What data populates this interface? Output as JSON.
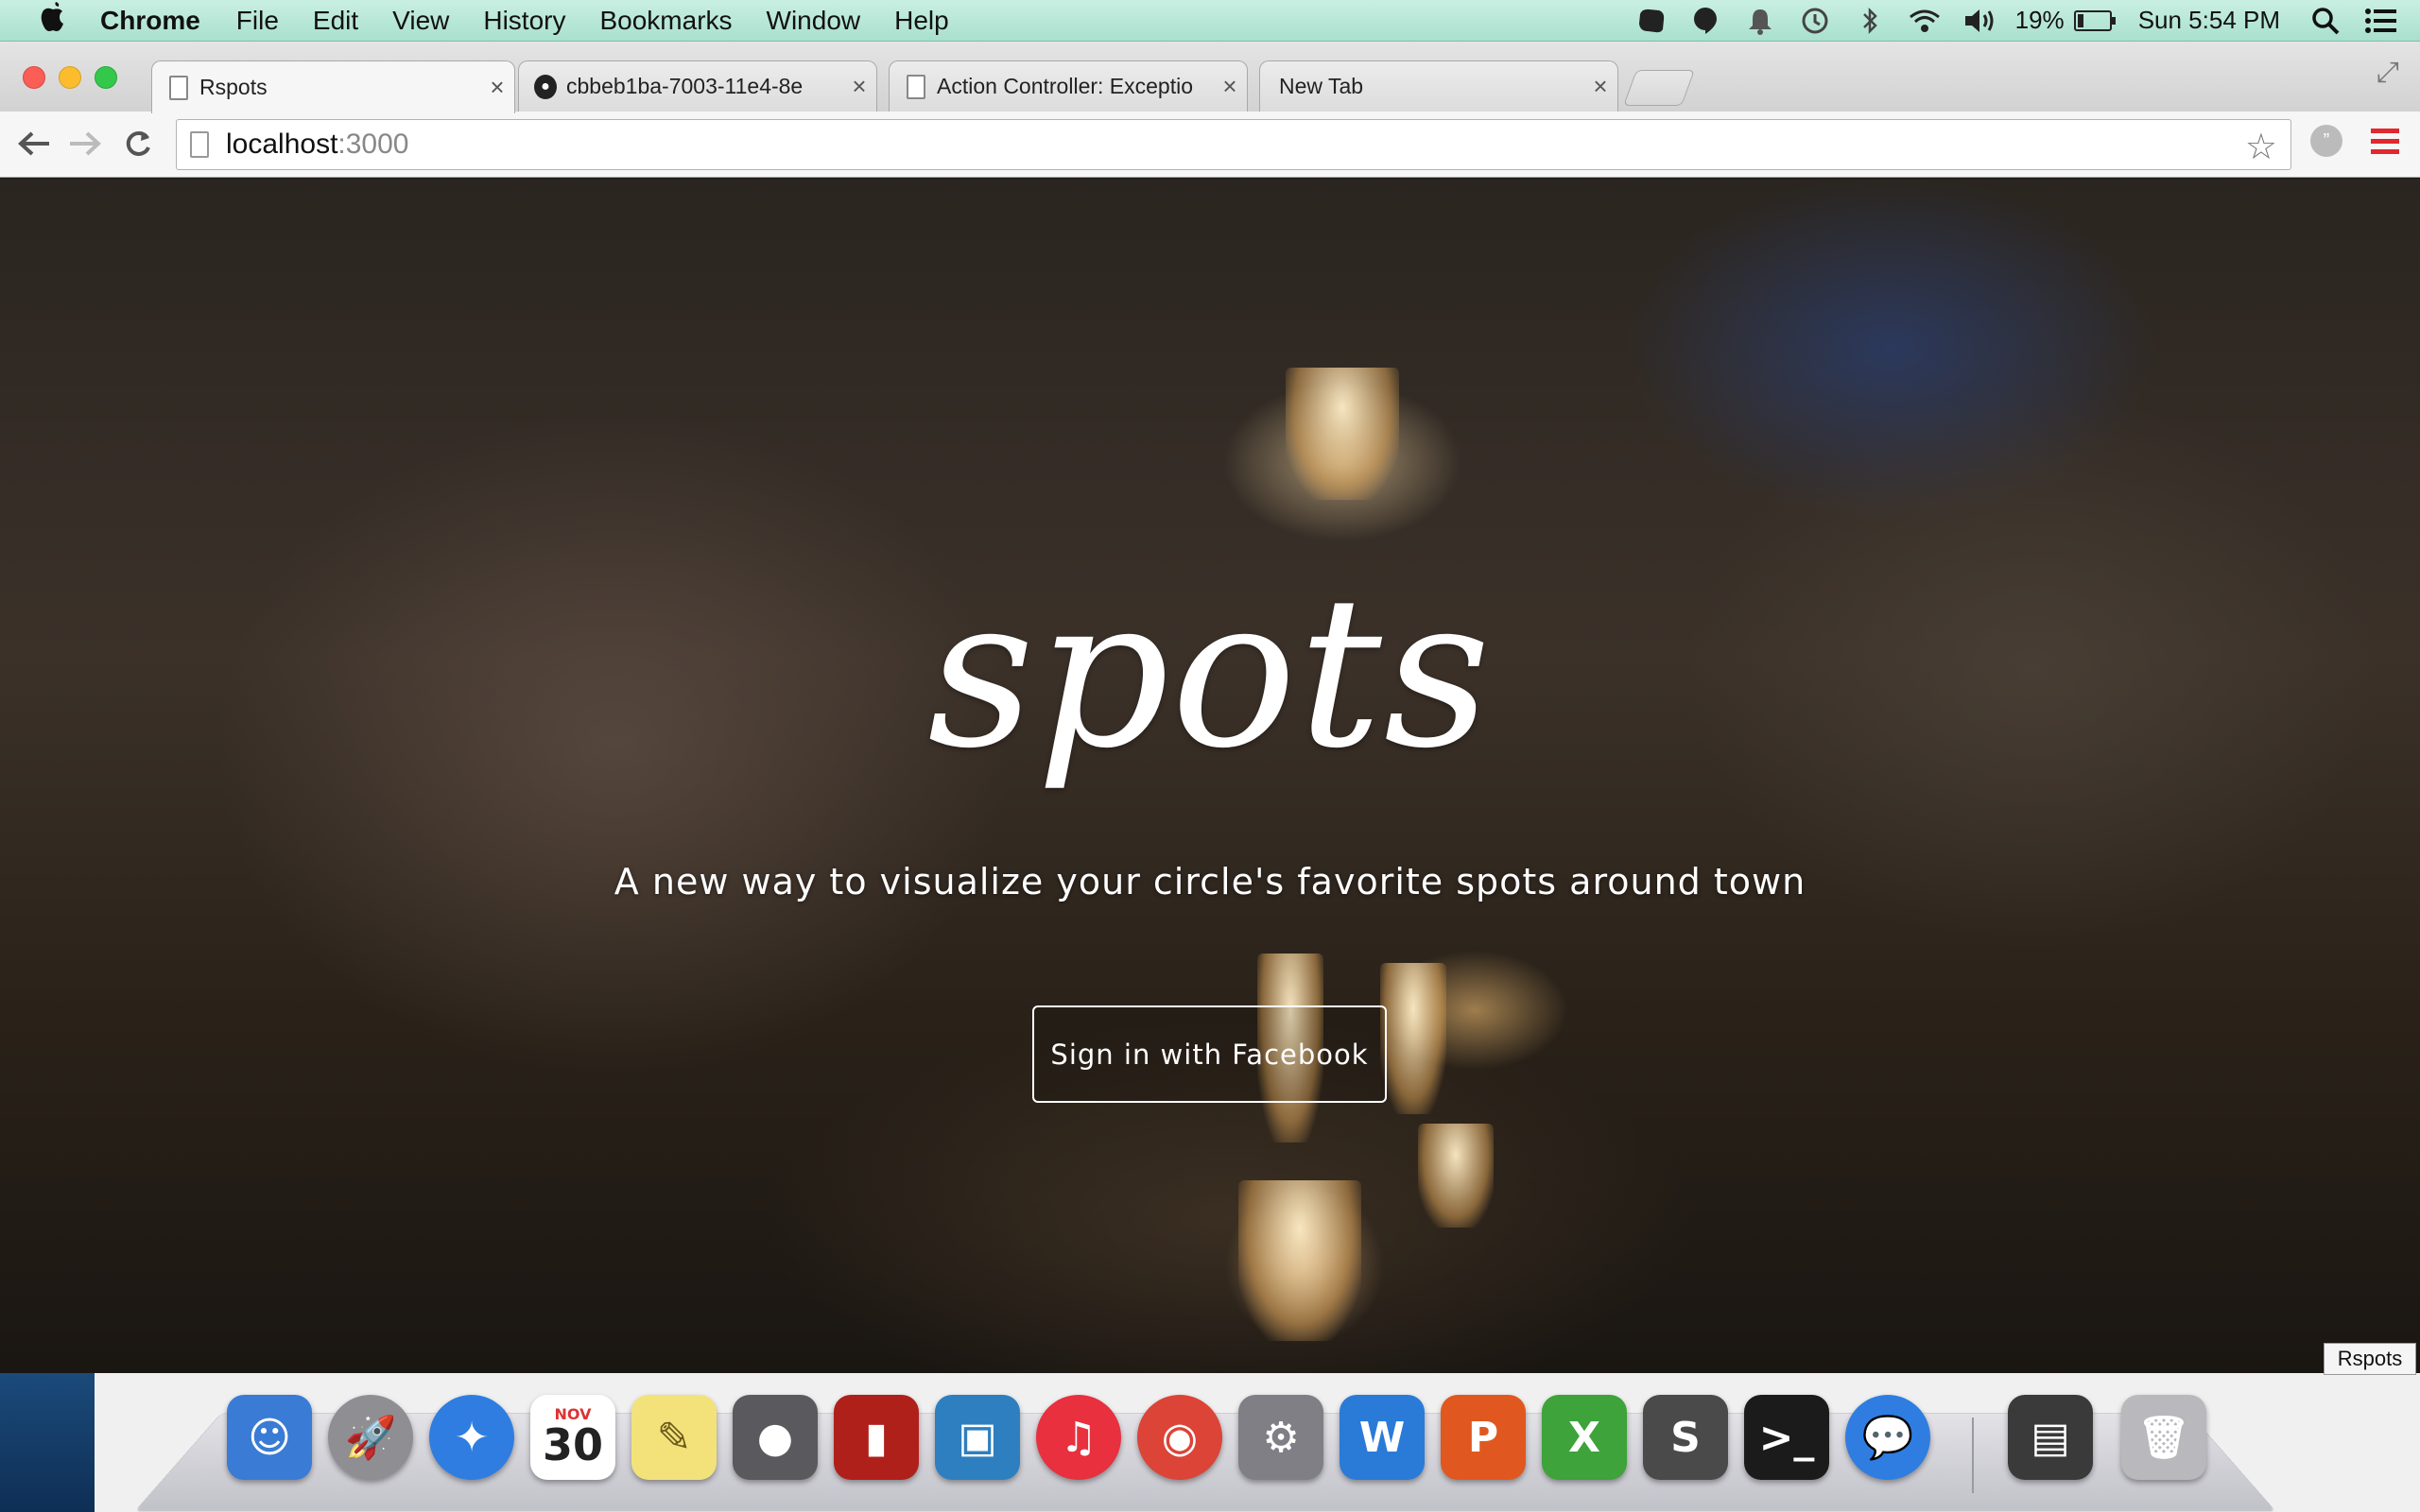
{
  "menubar": {
    "app_name": "Chrome",
    "items": [
      "File",
      "Edit",
      "View",
      "History",
      "Bookmarks",
      "Window",
      "Help"
    ],
    "battery_percent": "19%",
    "battery_level": 0.19,
    "clock": "Sun 5:54 PM",
    "status_icons": [
      "evernote-icon",
      "hangouts-icon",
      "notification-icon",
      "time-machine-icon",
      "bluetooth-icon",
      "wifi-icon",
      "volume-icon"
    ]
  },
  "tabs": [
    {
      "title": "Rspots",
      "favicon": "page-icon",
      "active": true
    },
    {
      "title": "cbbeb1ba-7003-11e4-8e",
      "favicon": "github-icon",
      "active": false
    },
    {
      "title": "Action Controller: Exceptio",
      "favicon": "page-icon",
      "active": false
    },
    {
      "title": "New Tab",
      "favicon": "none",
      "active": false
    }
  ],
  "toolbar": {
    "url_host": "localhost",
    "url_port": ":3000"
  },
  "page": {
    "title": "spots",
    "subtitle": "A new way to visualize your circle's favorite spots around town",
    "signin_label": "Sign in with Facebook",
    "hover_tooltip": "Rspots"
  },
  "dock": {
    "apps": [
      {
        "name": "finder-icon",
        "glyph": "☺",
        "color": "#3a7bd5"
      },
      {
        "name": "launchpad-icon",
        "glyph": "🚀",
        "color": "#8e8e93"
      },
      {
        "name": "safari-icon",
        "glyph": "✦",
        "color": "#2f7de1"
      },
      {
        "name": "calendar-icon",
        "glyph": "30",
        "color": "#ffffff"
      },
      {
        "name": "stickies-icon",
        "glyph": "✎",
        "color": "#f3e27a"
      },
      {
        "name": "facetime-icon",
        "glyph": "●",
        "color": "#5a5a5e"
      },
      {
        "name": "photo-booth-icon",
        "glyph": "▮",
        "color": "#b0201b"
      },
      {
        "name": "iphoto-icon",
        "glyph": "▣",
        "color": "#2e7fbf"
      },
      {
        "name": "itunes-icon",
        "glyph": "♫",
        "color": "#e8303f"
      },
      {
        "name": "chrome-icon",
        "glyph": "◉",
        "color": "#db4437"
      },
      {
        "name": "system-preferences-icon",
        "glyph": "⚙",
        "color": "#7f7f85"
      },
      {
        "name": "word-icon",
        "glyph": "W",
        "color": "#2a7bd8"
      },
      {
        "name": "powerpoint-icon",
        "glyph": "P",
        "color": "#e0581f"
      },
      {
        "name": "excel-icon",
        "glyph": "X",
        "color": "#3da33a"
      },
      {
        "name": "sublime-text-icon",
        "glyph": "S",
        "color": "#4a4a4a"
      },
      {
        "name": "terminal-icon",
        "glyph": ">_",
        "color": "#1b1b1b"
      },
      {
        "name": "messages-icon",
        "glyph": "💬",
        "color": "#2f7de1"
      }
    ],
    "right": [
      {
        "name": "console-icon",
        "glyph": "▤",
        "color": "#3a3a3a"
      },
      {
        "name": "trash-icon",
        "glyph": "🗑",
        "color": "#b8b8bd"
      }
    ],
    "calendar_month": "NOV"
  }
}
